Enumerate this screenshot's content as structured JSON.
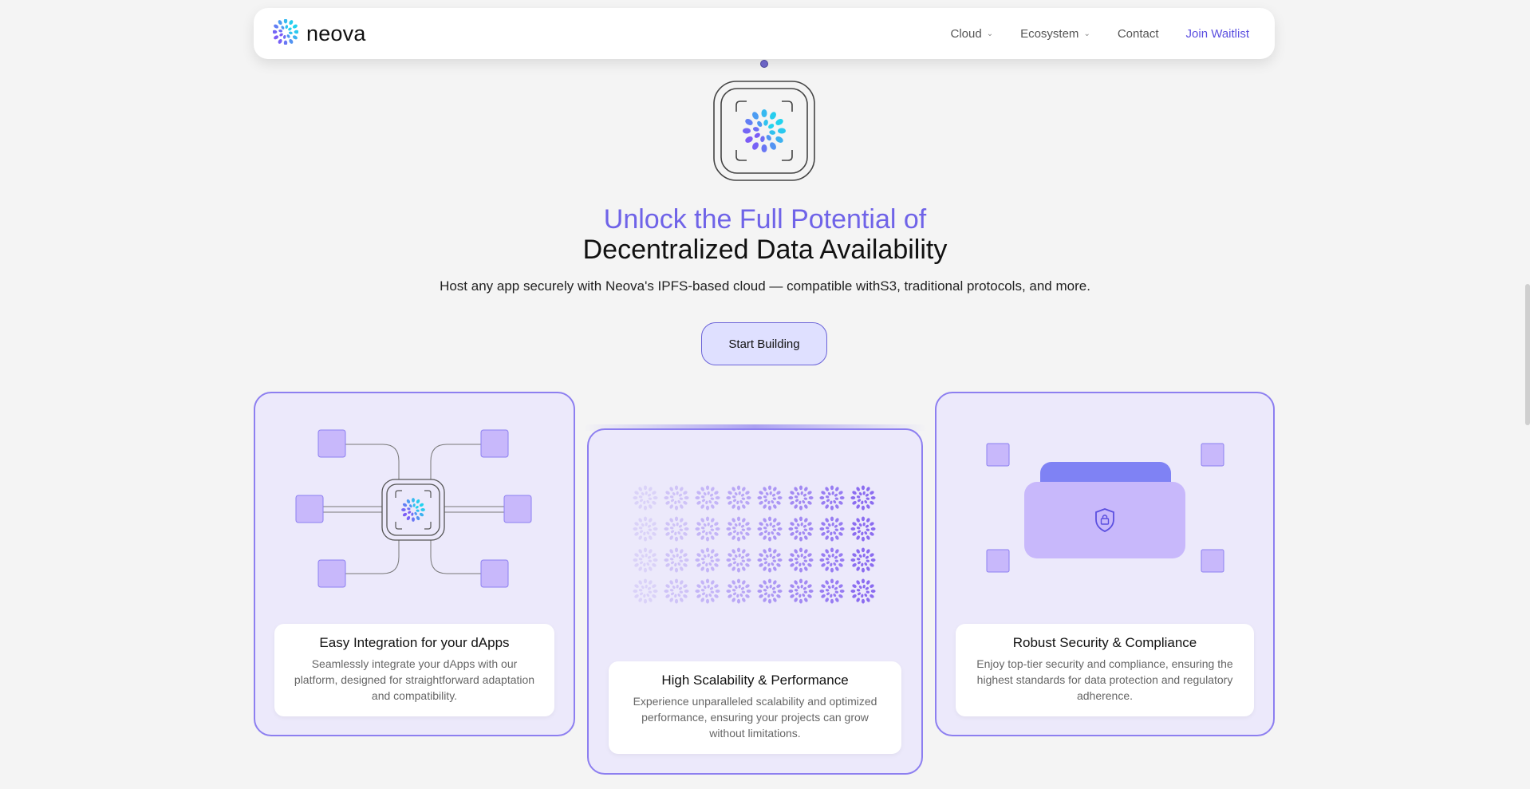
{
  "nav": {
    "brand": "neova",
    "items": [
      {
        "label": "Cloud",
        "dropdown": true
      },
      {
        "label": "Ecosystem",
        "dropdown": true
      },
      {
        "label": "Contact",
        "dropdown": false
      }
    ],
    "waitlist_label": "Join Waitlist"
  },
  "hero": {
    "title_accent": "Unlock the Full Potential of",
    "title_main": "Decentralized Data Availability",
    "subtitle": "Host any app securely with Neova's IPFS-based cloud — compatible withS3, traditional protocols, and more.",
    "cta_label": "Start Building"
  },
  "cards": [
    {
      "title": "Easy Integration for your dApps",
      "desc": "Seamlessly integrate your dApps with our platform, designed for straightforward adaptation and compatibility."
    },
    {
      "title": "High Scalability & Performance",
      "desc": "Experience unparalleled scalability and optimized performance, ensuring your projects can grow without limitations."
    },
    {
      "title": "Robust Security & Compliance",
      "desc": "Enjoy top-tier security and compliance, ensuring the highest standards for data protection and regulatory adherence."
    }
  ],
  "colors": {
    "accent": "#6f63e8",
    "card_border": "#8d7ff0",
    "card_bg": "#ece9fb",
    "block": "#c8b8fb",
    "lock_top": "#7f82f4"
  },
  "icons": [
    "neova-logo-icon",
    "chevron-down-icon",
    "chip-icon",
    "shield-lock-icon"
  ]
}
